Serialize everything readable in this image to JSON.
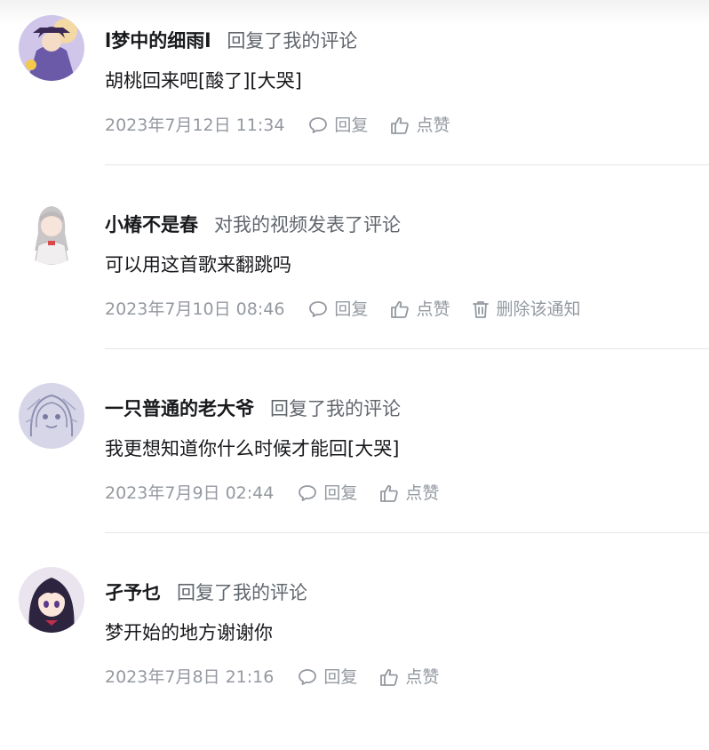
{
  "notifications": [
    {
      "username": "l梦中的细雨l",
      "action": "回复了我的评论",
      "content": "胡桃回来吧[酸了][大哭]",
      "time": "2023年7月12日 11:34",
      "reply_label": "回复",
      "like_label": "点赞"
    },
    {
      "username": "小椿不是春",
      "action": "对我的视频发表了评论",
      "content": "可以用这首歌来翻跳吗",
      "time": "2023年7月10日 08:46",
      "reply_label": "回复",
      "like_label": "点赞",
      "delete_label": "删除该通知"
    },
    {
      "username": "一只普通的老大爷",
      "action": "回复了我的评论",
      "content": "我更想知道你什么时候才能回[大哭]",
      "time": "2023年7月9日 02:44",
      "reply_label": "回复",
      "like_label": "点赞"
    },
    {
      "username": "孑予乜",
      "action": "回复了我的评论",
      "content": "梦开始的地方谢谢你",
      "time": "2023年7月8日 21:16",
      "reply_label": "回复",
      "like_label": "点赞"
    }
  ],
  "icons": {
    "reply": "chat-bubble-icon",
    "like": "thumbs-up-icon",
    "delete": "trash-icon"
  },
  "colors": {
    "username": "#18191c",
    "action_text": "#61666d",
    "meta_text": "#9499a0",
    "divider": "#e3e5e7"
  }
}
